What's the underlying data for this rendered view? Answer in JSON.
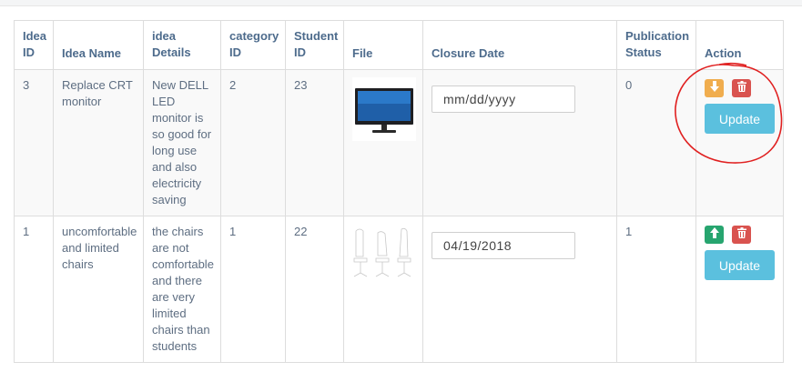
{
  "table": {
    "headers": {
      "idea_id": "Idea ID",
      "idea_name": "Idea Name",
      "idea_details": "idea Details",
      "category_id": "category ID",
      "student_id": "Student ID",
      "file": "File",
      "closure_date": "Closure Date",
      "publication_status": "Publication Status",
      "action": "Action"
    },
    "rows": [
      {
        "idea_id": "3",
        "idea_name": "Replace CRT monitor",
        "idea_details": "New DELL LED monitor is so good for long use and also electricity saving",
        "category_id": "2",
        "student_id": "23",
        "file_icon": "monitor-image",
        "closure_date_value": "",
        "closure_date_placeholder": "mm/dd/yyyy",
        "publication_status": "0",
        "status_icon": "arrow-down-icon",
        "update_label": "Update"
      },
      {
        "idea_id": "1",
        "idea_name": "uncomfortable and limited chairs",
        "idea_details": "the chairs are not comfortable and there are very limited chairs than students",
        "category_id": "1",
        "student_id": "22",
        "file_icon": "chairs-sketch-image",
        "closure_date_value": "04/19/2018",
        "closure_date_placeholder": "mm/dd/yyyy",
        "publication_status": "1",
        "status_icon": "arrow-up-icon",
        "update_label": "Update"
      }
    ]
  },
  "colors": {
    "orange": "#f0ad4e",
    "red": "#d9534f",
    "green": "#27a56f",
    "info": "#5bc0de",
    "header_text": "#4d6b8c",
    "annotation": "#e02020"
  }
}
